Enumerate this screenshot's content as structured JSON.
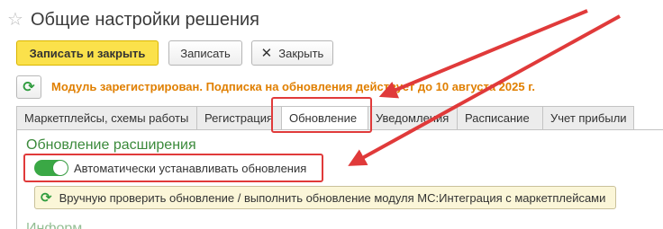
{
  "window": {
    "title": "Общие настройки решения"
  },
  "toolbar": {
    "save_close_label": "Записать и закрыть",
    "save_label": "Записать",
    "close_label": "Закрыть"
  },
  "notice": {
    "text": "Модуль зарегистрирован. Подписка на обновления действует до 10 августа 2025 г."
  },
  "tabs": [
    {
      "label": "Маркетплейсы, схемы работы"
    },
    {
      "label": "Регистрация"
    },
    {
      "label": "Обновление"
    },
    {
      "label": "Уведомления"
    },
    {
      "label": "Расписание"
    },
    {
      "label": "Учет прибыли"
    }
  ],
  "update_section": {
    "title": "Обновление расширения",
    "auto_update_label": "Автоматически устанавливать обновления",
    "auto_update_enabled": true,
    "check_button_label": "Вручную проверить обновление / выполнить обновление модуля МС:Интеграция с маркетплейсами",
    "next_section_partial": "Информ"
  },
  "colors": {
    "accent_yellow": "#fbe14b",
    "notice_orange": "#e07f00",
    "section_green": "#3b8a3b",
    "toggle_green": "#3aa845",
    "annotation_red": "#e03a3a"
  }
}
